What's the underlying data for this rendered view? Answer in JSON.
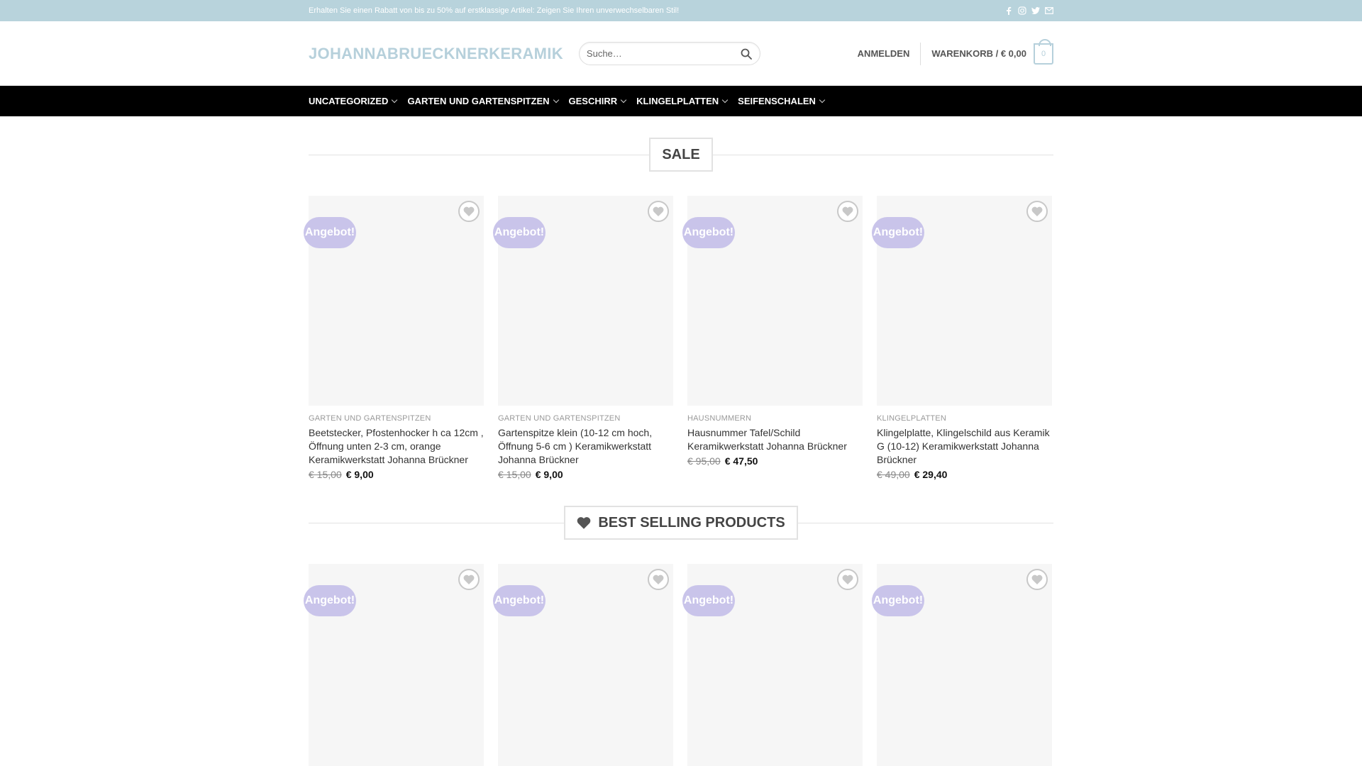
{
  "topbar": {
    "promo": "Erhalten Sie einen Rabatt von bis zu 50% auf erstklassige Artikel: Zeigen Sie Ihren unverwechselbaren Stil!",
    "social_icons": [
      "facebook-icon",
      "instagram-icon",
      "twitter-icon",
      "mail-icon"
    ]
  },
  "header": {
    "logo": "JOHANNABRUECKNERKERAMIK",
    "search_placeholder": "Suche…",
    "login": "ANMELDEN",
    "cart_label": "WARENKORB / € 0,00",
    "cart_count": "0"
  },
  "nav": {
    "items": [
      "UNCATEGORIZED",
      "GARTEN UND GARTENSPITZEN",
      "GESCHIRR",
      "KLINGELPLATTEN",
      "SEIFENSCHALEN"
    ]
  },
  "sale": {
    "title": "SALE",
    "products": [
      {
        "badge": "Angebot!",
        "category": "GARTEN UND GARTENSPITZEN",
        "title": "Beetstecker, Pfostenhocker h ca 12cm , Öffnung unten 2-3 cm, orange Keramikwerkstatt Johanna Brückner",
        "old_price": "€ 15,00",
        "new_price": "€ 9,00"
      },
      {
        "badge": "Angebot!",
        "category": "GARTEN UND GARTENSPITZEN",
        "title": "Gartenspitze klein (10-12 cm hoch, Öffnung 5-6 cm ) Keramikwerkstatt Johanna Brückner",
        "old_price": "€ 15,00",
        "new_price": "€ 9,00"
      },
      {
        "badge": "Angebot!",
        "category": "HAUSNUMMERN",
        "title": "Hausnummer Tafel/Schild Keramikwerkstatt Johanna Brückner",
        "old_price": "€ 95,00",
        "new_price": "€ 47,50"
      },
      {
        "badge": "Angebot!",
        "category": "KLINGELPLATTEN",
        "title": "Klingelplatte, Klingelschild aus Keramik G (10-12) Keramikwerkstatt Johanna Brückner",
        "old_price": "€ 49,00",
        "new_price": "€ 29,40"
      }
    ]
  },
  "best": {
    "title": "BEST SELLING PRODUCTS",
    "badges": [
      "Angebot!",
      "Angebot!",
      "Angebot!",
      "Angebot!"
    ]
  },
  "colors": {
    "topbar": "#b8d3dc",
    "accent": "#b6d0db",
    "badge": "#c9c4ea",
    "nav": "#000000"
  }
}
